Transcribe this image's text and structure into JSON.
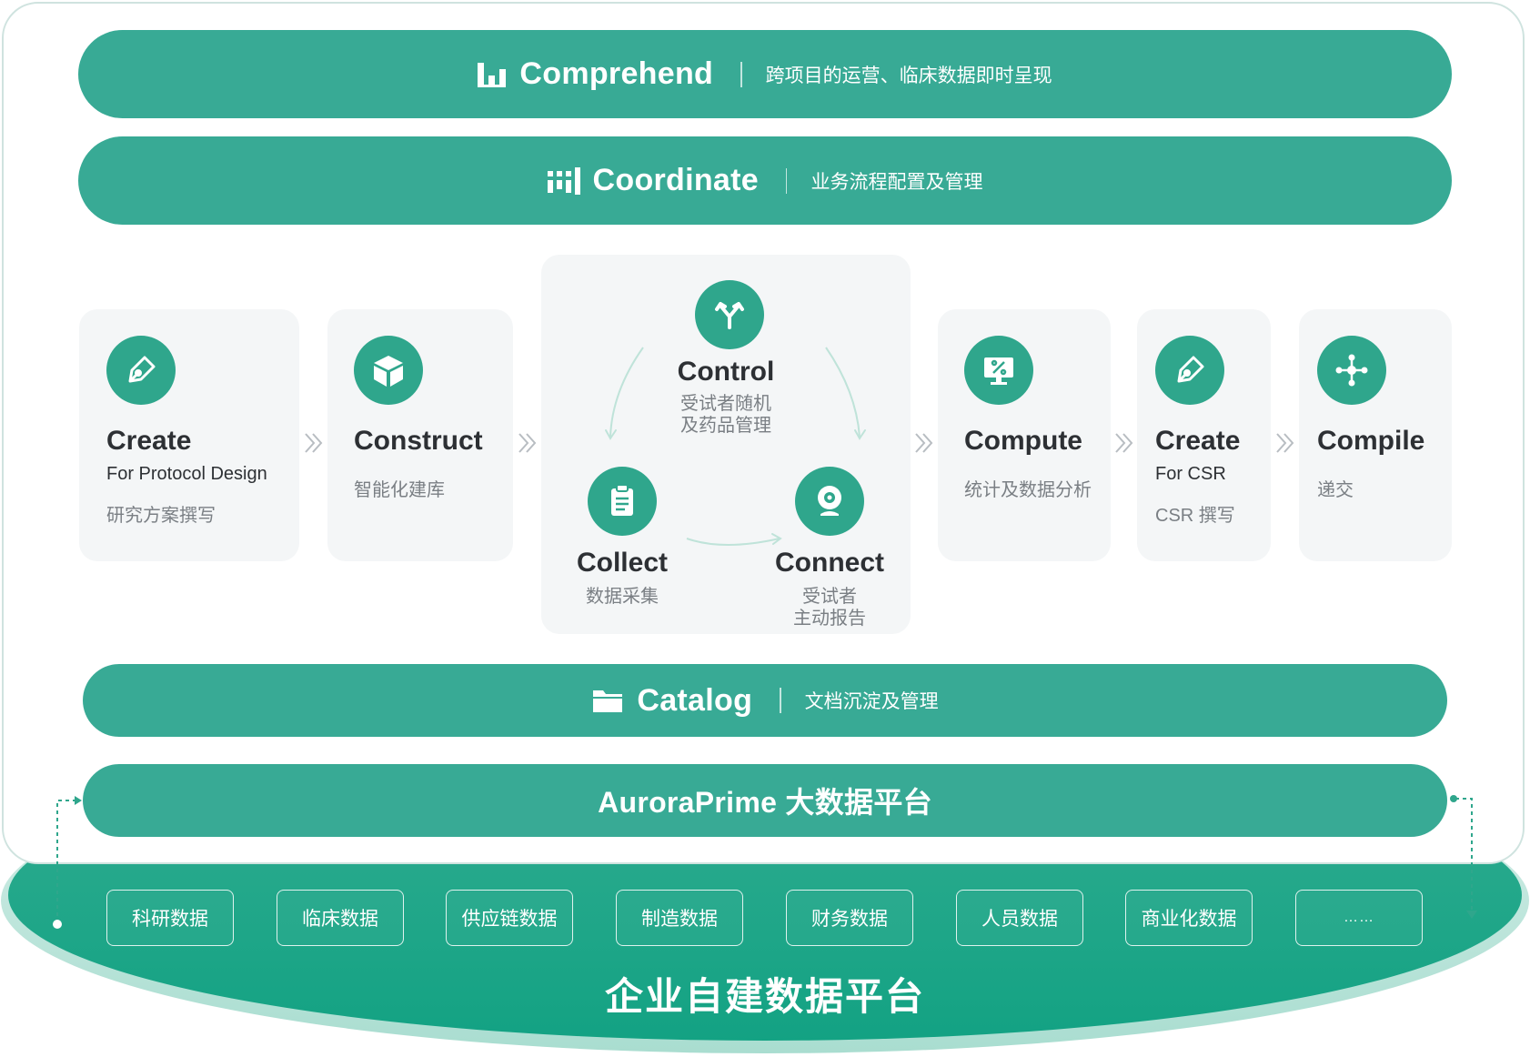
{
  "bands": {
    "comprehend": {
      "title": "Comprehend",
      "subtitle": "跨项目的运营、临床数据即时呈现",
      "icon": "bar-chart-icon"
    },
    "coordinate": {
      "title": "Coordinate",
      "subtitle": "业务流程配置及管理",
      "icon": "grid-bars-icon"
    },
    "catalog": {
      "title": "Catalog",
      "subtitle": "文档沉淀及管理",
      "icon": "folder-icon"
    },
    "platform": {
      "title": "AuroraPrime 大数据平台"
    }
  },
  "steps": {
    "create_protocol": {
      "title": "Create",
      "en": "For Protocol Design",
      "zh": "研究方案撰写",
      "icon": "pen-nib-icon"
    },
    "construct": {
      "title": "Construct",
      "zh": "智能化建库",
      "icon": "cube-icon"
    },
    "control": {
      "title": "Control",
      "zh_line1": "受试者随机",
      "zh_line2": "及药品管理",
      "icon": "split-arrows-icon"
    },
    "collect": {
      "title": "Collect",
      "zh": "数据采集",
      "icon": "clipboard-icon"
    },
    "connect": {
      "title": "Connect",
      "zh_line1": "受试者",
      "zh_line2": "主动报告",
      "icon": "webcam-icon"
    },
    "compute": {
      "title": "Compute",
      "zh": "统计及数据分析",
      "icon": "monitor-percent-icon"
    },
    "create_csr": {
      "title": "Create",
      "en": "For CSR",
      "zh": "CSR 撰写",
      "icon": "pen-nib-icon"
    },
    "compile": {
      "title": "Compile",
      "zh": "递交",
      "icon": "hub-nodes-icon"
    }
  },
  "base": {
    "title": "企业自建数据平台",
    "sources": [
      "科研数据",
      "临床数据",
      "供应链数据",
      "制造数据",
      "财务数据",
      "人员数据",
      "商业化数据",
      "……"
    ]
  },
  "colors": {
    "band": "#38aa95",
    "icon_circle": "#2fa68c",
    "card_bg": "#f4f6f7",
    "base_ellipse": "#1ea58a",
    "frame_border": "#cfe3df"
  }
}
